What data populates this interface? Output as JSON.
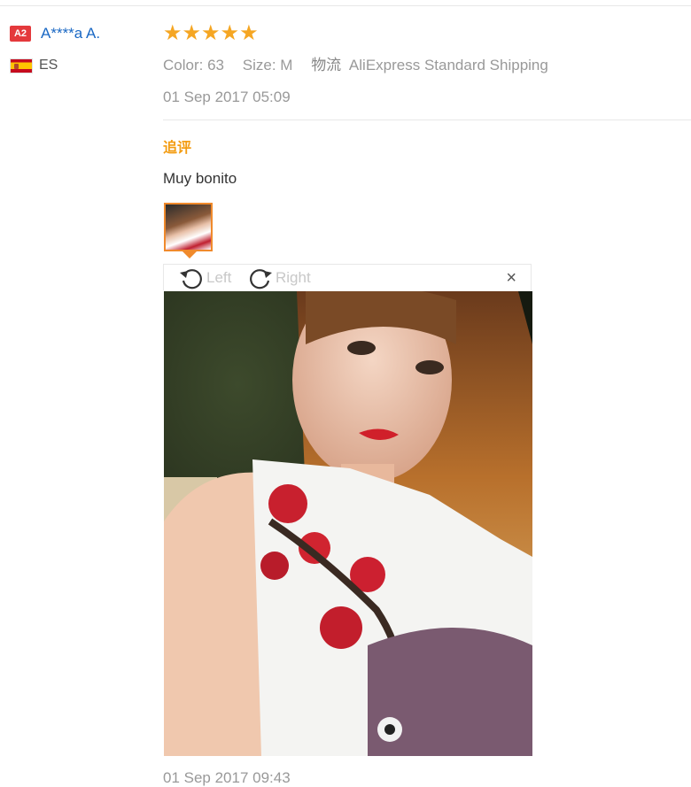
{
  "review": {
    "user": {
      "level_badge": "A2",
      "name": "A****a A.",
      "country": "ES",
      "flag_icon": "spain-flag-icon"
    },
    "rating": {
      "stars": 5,
      "max": 5,
      "display": "★★★★★"
    },
    "attributes": {
      "color_label": "Color:",
      "color_value": "63",
      "size_label": "Size:",
      "size_value": "M",
      "shipping_label": "物流",
      "shipping_value": "AliExpress Standard Shipping"
    },
    "date": "01 Sep 2017 05:09",
    "followup": {
      "title": "追评",
      "text": "Muy bonito",
      "date": "01 Sep 2017 09:43"
    }
  },
  "viewer": {
    "rotate_left_label": "Left",
    "rotate_right_label": "Right",
    "close_glyph": "×"
  },
  "colors": {
    "star": "#f5a623",
    "link": "#1a68c4",
    "accent": "#f39c12",
    "badge": "#e4393c",
    "thumb_border": "#f08a2c"
  }
}
